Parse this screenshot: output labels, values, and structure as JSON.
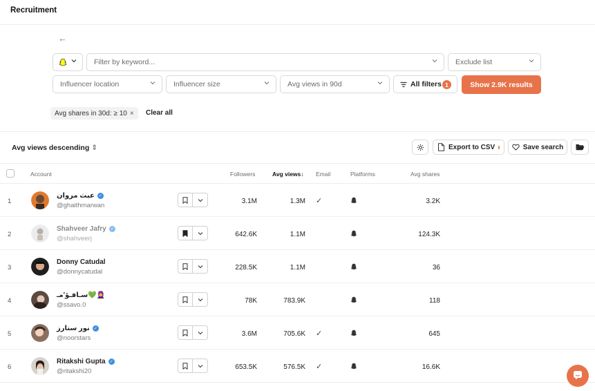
{
  "header": {
    "title": "Recruitment"
  },
  "filters": {
    "platform_select": {
      "icon": "snapchat-ghost-icon"
    },
    "keyword": {
      "placeholder": "Filter by keyword..."
    },
    "exclude_list": "Exclude list",
    "influencer_location": "Influencer location",
    "influencer_size": "Influencer size",
    "avg_views": "Avg views in 90d",
    "all_filters": {
      "label": "All filters",
      "count": "1"
    },
    "show_results": "Show 2.9K results",
    "active_chip": "Avg shares in 30d: ≥ 10",
    "chip_remove": "×",
    "clear_all": "Clear all"
  },
  "toolbar": {
    "sort_label": "Avg views descending",
    "export_label": "Export to CSV",
    "save_search_label": "Save search"
  },
  "table": {
    "columns": {
      "account": "Account",
      "followers": "Followers",
      "avg_views": "Avg views",
      "avg_views_arrow": "↓",
      "email": "Email",
      "platforms": "Platforms",
      "avg_shares": "Avg shares"
    },
    "rows": [
      {
        "index": "1",
        "name": "عبث مروان",
        "handle": "@ghaithmarwan",
        "verified": true,
        "saved": false,
        "followers": "3.1M",
        "avg_views": "1.3M",
        "email": "✓",
        "avg_shares": "3.2K"
      },
      {
        "index": "2",
        "name": "Shahveer Jafry",
        "handle": "@shahveerj",
        "verified": true,
        "saved": true,
        "followers": "642.6K",
        "avg_views": "1.1M",
        "email": "",
        "avg_shares": "124.3K"
      },
      {
        "index": "3",
        "name": "Donny Catudal",
        "handle": "@donnycatudal",
        "verified": false,
        "saved": false,
        "followers": "228.5K",
        "avg_views": "1.1M",
        "email": "",
        "avg_shares": "36"
      },
      {
        "index": "4",
        "name": "سـافـؤ'مـ💚🧕",
        "handle": "@ssavo.0",
        "verified": false,
        "saved": false,
        "followers": "78K",
        "avg_views": "783.9K",
        "email": "",
        "avg_shares": "118"
      },
      {
        "index": "5",
        "name": "نور ستارز",
        "handle": "@noorstars",
        "verified": true,
        "saved": false,
        "followers": "3.6M",
        "avg_views": "705.6K",
        "email": "✓",
        "avg_shares": "645"
      },
      {
        "index": "6",
        "name": "Ritakshi Gupta",
        "handle": "@ritakshi20",
        "verified": true,
        "saved": false,
        "followers": "653.5K",
        "avg_views": "576.5K",
        "email": "✓",
        "avg_shares": "16.6K"
      }
    ]
  },
  "colors": {
    "accent": "#e8734a",
    "verified": "#3d8fe0",
    "border": "#d9d9d9"
  }
}
